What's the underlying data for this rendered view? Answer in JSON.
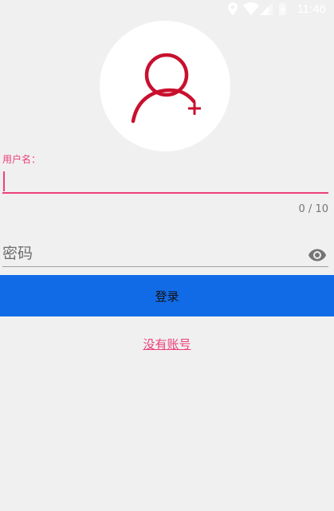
{
  "status_bar": {
    "time": "11:46",
    "icons": [
      "location-icon",
      "wifi-icon",
      "signal-icon",
      "battery-icon"
    ]
  },
  "avatar": {
    "icon": "add-user-icon",
    "color": "#c8102e"
  },
  "username": {
    "label": "用户名：",
    "value": "",
    "counter": "0 / 10",
    "accent_color": "#ec407a"
  },
  "password": {
    "placeholder": "密码",
    "toggle_icon": "eye-icon"
  },
  "login_button": {
    "label": "登录",
    "color": "#126be6"
  },
  "register_link": {
    "label": "没有账号"
  }
}
